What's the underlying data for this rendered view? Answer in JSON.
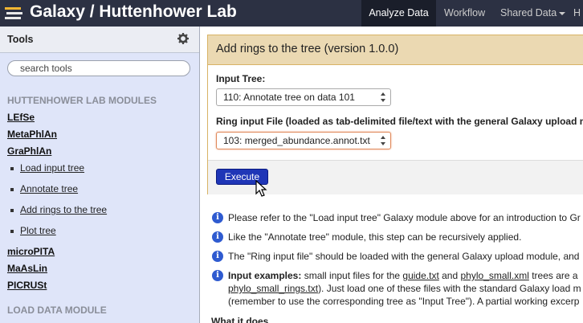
{
  "masthead": {
    "brand": "Galaxy / Huttenhower Lab",
    "nav": [
      "Analyze Data",
      "Workflow",
      "Shared Data",
      "H"
    ]
  },
  "tools": {
    "title": "Tools",
    "search_placeholder": "search tools",
    "section1": "HUTTENHOWER LAB MODULES",
    "items": [
      "LEfSe",
      "MetaPhlAn",
      "GraPhlAn"
    ],
    "graphlan_sub": [
      "Load input tree",
      "Annotate tree",
      "Add rings to the tree",
      "Plot tree"
    ],
    "items2": [
      "microPITA",
      "MaAsLin",
      "PICRUSt"
    ],
    "section2": "LOAD DATA MODULE"
  },
  "form": {
    "title": "Add rings to the tree (version 1.0.0)",
    "input_tree_label": "Input Tree:",
    "input_tree_value": "110: Annotate tree on data 101",
    "ring_label": "Ring input File (loaded as tab-delimited file/text with the general Galaxy upload m",
    "ring_value": "103: merged_abundance.annot.txt",
    "execute": "Execute"
  },
  "help": {
    "line1": "Please refer to the \"Load input tree\" Galaxy module above for an introduction to Gr",
    "line2": "Like the \"Annotate tree\" module, this step can be recursively applied.",
    "line3": "The \"Ring input file\" should be loaded with the general Galaxy upload module, and",
    "ex_bold": "Input examples:",
    "ex_a": " small input files for the ",
    "ex_link1": "guide.txt",
    "ex_b": " and ",
    "ex_link2": "phylo_small.xml",
    "ex_c": "  trees are a",
    "ex_link3": "phylo_small_rings.txt",
    "ex_d": "). Just load one of these files with the standard Galaxy load m",
    "ex_line3": "(remember to use the corresponding tree as \"Input Tree\"). A partial working excerp",
    "what": "What it does"
  }
}
